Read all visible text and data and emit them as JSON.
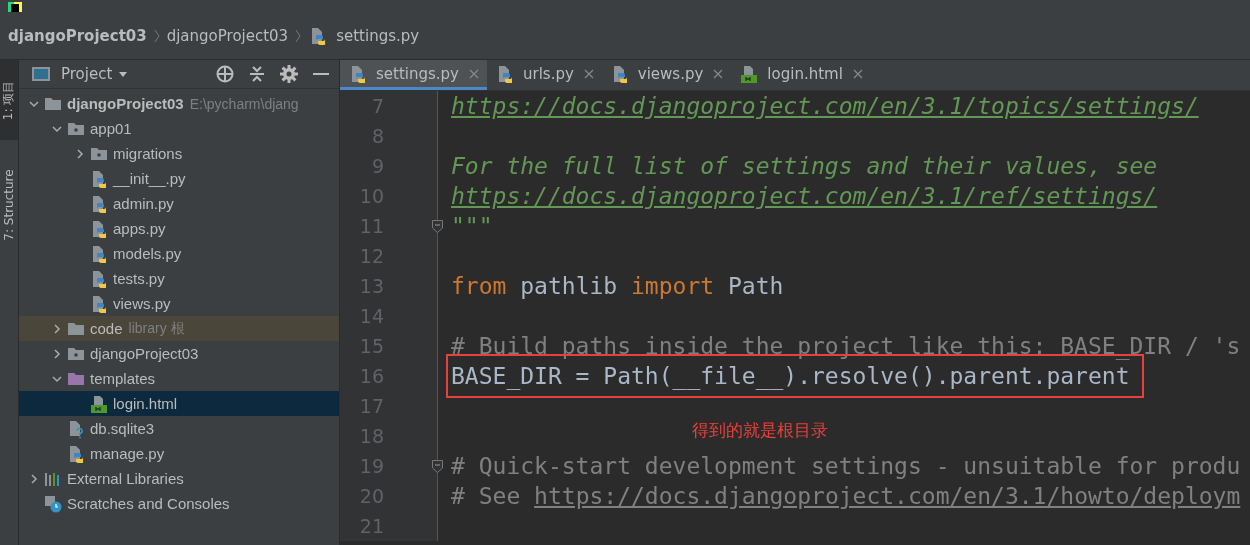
{
  "breadcrumbs": [
    {
      "label": "djangoProject03",
      "kind": "project"
    },
    {
      "label": "djangoProject03",
      "kind": "folder"
    },
    {
      "label": "settings.py",
      "kind": "python"
    }
  ],
  "tool_strip": [
    {
      "label": "1: 项目",
      "selected": true
    },
    {
      "label": "7: Structure",
      "selected": false
    }
  ],
  "project_panel": {
    "title": "Project",
    "tree": [
      {
        "label": "djangoProject03",
        "hint": "E:\\pycharm\\djang",
        "kind": "folder",
        "expanded": true,
        "selected": false,
        "highlighted": false,
        "children": [
          {
            "label": "app01",
            "kind": "module",
            "expanded": true,
            "selected": false,
            "highlighted": false,
            "children": [
              {
                "label": "migrations",
                "kind": "module",
                "expanded": false,
                "selected": false,
                "highlighted": false
              },
              {
                "label": "__init__.py",
                "kind": "python",
                "selected": false,
                "highlighted": false
              },
              {
                "label": "admin.py",
                "kind": "python",
                "selected": false,
                "highlighted": false
              },
              {
                "label": "apps.py",
                "kind": "python",
                "selected": false,
                "highlighted": false
              },
              {
                "label": "models.py",
                "kind": "python",
                "selected": false,
                "highlighted": false
              },
              {
                "label": "tests.py",
                "kind": "python",
                "selected": false,
                "highlighted": false
              },
              {
                "label": "views.py",
                "kind": "python",
                "selected": false,
                "highlighted": false
              }
            ]
          },
          {
            "label": "code",
            "hint": "library 根",
            "kind": "folder",
            "expanded": false,
            "selected": false,
            "highlighted": true
          },
          {
            "label": "djangoProject03",
            "kind": "module",
            "expanded": false,
            "selected": false,
            "highlighted": false
          },
          {
            "label": "templates",
            "kind": "templates",
            "expanded": true,
            "selected": false,
            "highlighted": false,
            "children": [
              {
                "label": "login.html",
                "kind": "html",
                "selected": true,
                "highlighted": false
              }
            ]
          },
          {
            "label": "db.sqlite3",
            "kind": "unknown",
            "selected": false,
            "highlighted": false
          },
          {
            "label": "manage.py",
            "kind": "python",
            "selected": false,
            "highlighted": false
          }
        ]
      },
      {
        "label": "External Libraries",
        "kind": "libraries",
        "expanded": false,
        "selected": false,
        "highlighted": false
      },
      {
        "label": "Scratches and Consoles",
        "kind": "scratches",
        "selected": false,
        "highlighted": false
      }
    ]
  },
  "editor": {
    "tabs": [
      {
        "label": "settings.py",
        "kind": "python",
        "selected": true
      },
      {
        "label": "urls.py",
        "kind": "python",
        "selected": false
      },
      {
        "label": "views.py",
        "kind": "python",
        "selected": false
      },
      {
        "label": "login.html",
        "kind": "html",
        "selected": false
      }
    ],
    "lines": [
      {
        "number": "7",
        "tokens": [
          {
            "kind": "doc_link",
            "text": "https://docs.djangoproject.com/en/3.1/topics/settings/"
          }
        ]
      },
      {
        "number": "8"
      },
      {
        "number": "9",
        "tokens": [
          {
            "kind": "doc",
            "text": "For the full list of settings and their values, see"
          }
        ]
      },
      {
        "number": "10",
        "tokens": [
          {
            "kind": "doc_link",
            "text": "https://docs.djangoproject.com/en/3.1/ref/settings/"
          }
        ]
      },
      {
        "number": "11",
        "fold": true,
        "tokens": [
          {
            "kind": "doc",
            "text": "\"\"\""
          }
        ]
      },
      {
        "number": "12"
      },
      {
        "number": "13",
        "tokens": [
          {
            "kind": "keyword",
            "text": "from"
          },
          {
            "kind": "plain",
            "text": " pathlib "
          },
          {
            "kind": "keyword",
            "text": "import"
          },
          {
            "kind": "plain",
            "text": " Path"
          }
        ]
      },
      {
        "number": "14"
      },
      {
        "number": "15",
        "tokens": [
          {
            "kind": "comment",
            "text": "# Build paths inside the project like this: BASE_DIR / 's"
          }
        ]
      },
      {
        "number": "16",
        "boxed": true,
        "tokens": [
          {
            "kind": "plain",
            "text": "BASE_DIR = Path(__file__).resolve().parent.parent"
          }
        ]
      },
      {
        "number": "17"
      },
      {
        "number": "18"
      },
      {
        "number": "19",
        "fold": true,
        "tokens": [
          {
            "kind": "comment",
            "text": "# Quick-start development settings - unsuitable for produ"
          }
        ]
      },
      {
        "number": "20",
        "tokens": [
          {
            "kind": "comment",
            "text": "# See "
          },
          {
            "kind": "link",
            "text": "https://docs.djangoproject.com/en/3.1/howto/deploym"
          }
        ]
      },
      {
        "number": "21"
      }
    ],
    "annotation": "得到的就是根目录"
  }
}
